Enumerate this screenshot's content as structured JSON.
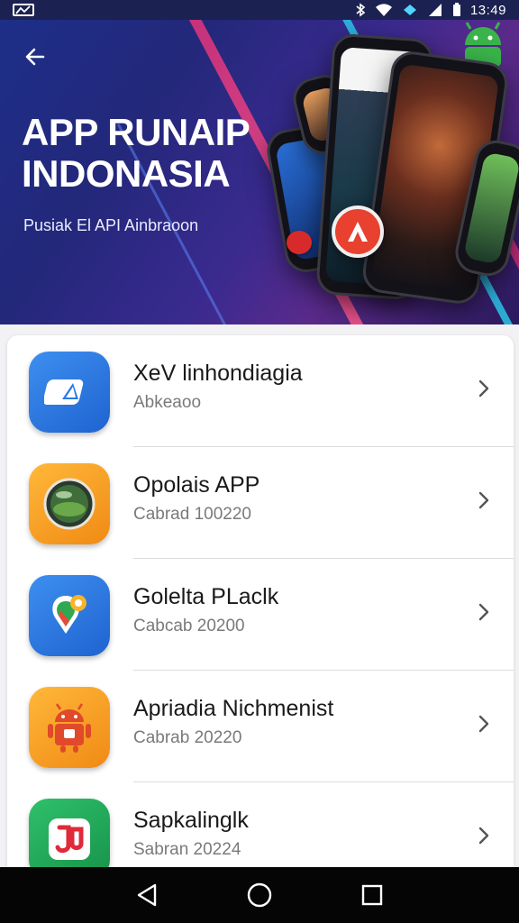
{
  "status_bar": {
    "time": "13:49",
    "icons": [
      "signal-notification-icon",
      "bluetooth-icon",
      "wifi-icon",
      "data-icon",
      "cell-signal-icon",
      "battery-icon"
    ]
  },
  "header": {
    "title": "APP RUNAIP INDONASIA",
    "subtitle": "Pusiak El API Ainbraoon",
    "back_icon": "back-arrow-icon",
    "colors": {
      "gradient_start": "#1d2f8a",
      "gradient_end": "#5a2a8a",
      "badge": "#e8412f"
    }
  },
  "apps": [
    {
      "name": "XeV linhondiagia",
      "subtitle": "Abkeaoo",
      "icon": "navigation-arrow-icon",
      "icon_bg": "#2f7de8"
    },
    {
      "name": "Opolais APP",
      "subtitle": "Cabrad 100220",
      "icon": "planet-globe-icon",
      "icon_bg": "#f6a12a"
    },
    {
      "name": "Golelta PLaclk",
      "subtitle": "Cabcab 20200",
      "icon": "map-pin-icon",
      "icon_bg": "#2f7de8"
    },
    {
      "name": "Apriadia Nichmenist",
      "subtitle": "Cabrab 20220",
      "icon": "android-robot-icon",
      "icon_bg": "#f6a12a"
    },
    {
      "name": "Sapkalinglk",
      "subtitle": "Sabran 20224",
      "icon": "music-note-icon",
      "icon_bg": "#22a85a"
    }
  ],
  "nav_bar": {
    "back": "nav-back-icon",
    "home": "nav-home-icon",
    "recents": "nav-recents-icon"
  }
}
